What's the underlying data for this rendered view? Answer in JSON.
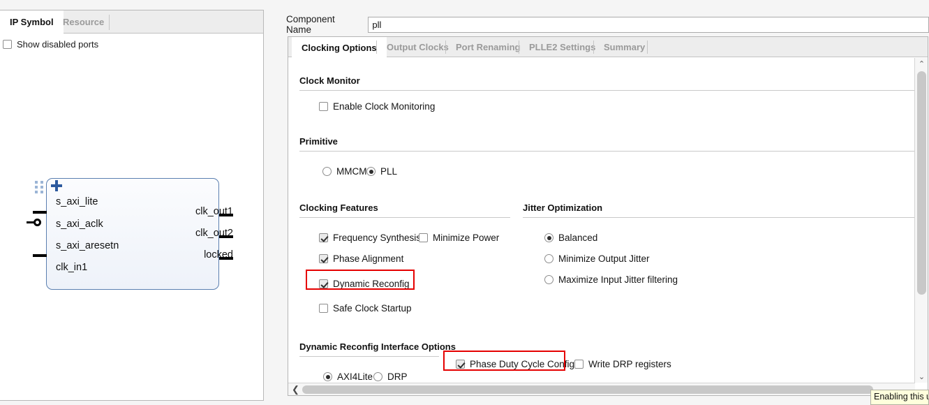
{
  "left_panel": {
    "tabs": [
      {
        "label": "IP Symbol",
        "active": true
      },
      {
        "label": "Resource",
        "active": false
      }
    ],
    "show_disabled_ports": {
      "label": "Show disabled ports",
      "checked": false
    },
    "ip_symbol": {
      "bus_port": "s_axi_lite",
      "left_ports": [
        "s_axi_aclk",
        "s_axi_aresetn",
        "clk_in1"
      ],
      "right_ports": [
        "clk_out1",
        "clk_out2",
        "locked"
      ]
    }
  },
  "component_name": {
    "label": "Component Name",
    "value": "pll",
    "placeholder": ""
  },
  "tabs": [
    {
      "label": "Clocking Options",
      "active": true
    },
    {
      "label": "Output Clocks",
      "active": false
    },
    {
      "label": "Port Renaming",
      "active": false
    },
    {
      "label": "PLLE2 Settings",
      "active": false
    },
    {
      "label": "Summary",
      "active": false
    }
  ],
  "sections": {
    "clock_monitor": {
      "title": "Clock Monitor",
      "enable_clock_monitoring": {
        "label": "Enable Clock Monitoring",
        "checked": false
      }
    },
    "primitive": {
      "title": "Primitive",
      "options": [
        {
          "label": "MMCM",
          "selected": false
        },
        {
          "label": "PLL",
          "selected": true
        }
      ]
    },
    "clocking_features": {
      "title": "Clocking Features",
      "options": [
        {
          "label": "Frequency Synthesis",
          "checked": true,
          "highlighted": false
        },
        {
          "label": "Minimize Power",
          "checked": false,
          "highlighted": false
        },
        {
          "label": "Phase Alignment",
          "checked": true,
          "highlighted": false
        },
        {
          "label": "Dynamic Reconfig",
          "checked": true,
          "highlighted": true
        },
        {
          "label": "Safe Clock Startup",
          "checked": false,
          "highlighted": false
        }
      ]
    },
    "jitter_optimization": {
      "title": "Jitter Optimization",
      "options": [
        {
          "label": "Balanced",
          "selected": true
        },
        {
          "label": "Minimize Output Jitter",
          "selected": false
        },
        {
          "label": "Maximize Input Jitter filtering",
          "selected": false
        }
      ]
    },
    "dynamic_reconfig": {
      "title": "Dynamic Reconfig Interface Options",
      "interface_options": [
        {
          "label": "AXI4Lite",
          "selected": true
        },
        {
          "label": "DRP",
          "selected": false
        }
      ],
      "checkboxes": [
        {
          "label": "Phase Duty Cycle Config",
          "checked": true,
          "highlighted": true
        },
        {
          "label": "Write DRP registers",
          "checked": false,
          "highlighted": false
        }
      ]
    }
  },
  "tooltip": {
    "text": "Enabling this u"
  },
  "scrollbars": {
    "vertical_up": "⌃",
    "vertical_down": "⌄",
    "horizontal_left": "❮"
  },
  "colors": {
    "highlight": "#e50000",
    "symbol_border": "#5b7fb0",
    "tooltip_bg": "#ffffdc"
  }
}
